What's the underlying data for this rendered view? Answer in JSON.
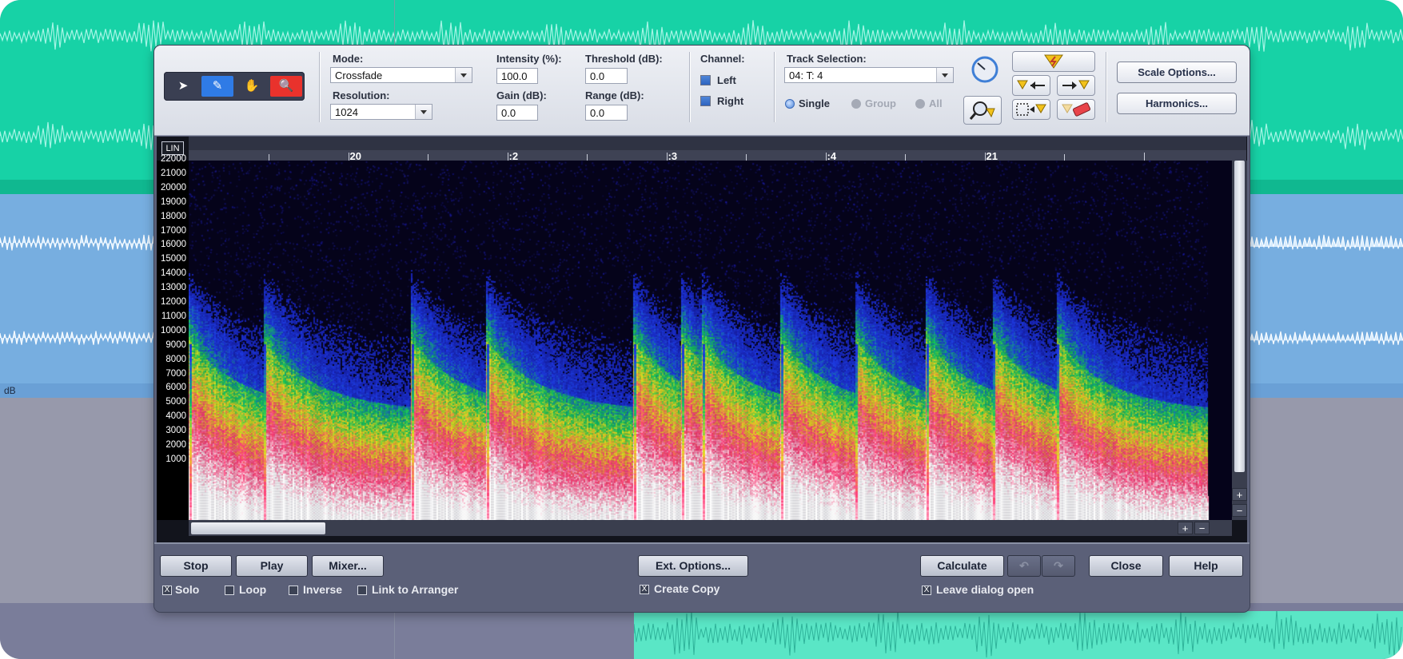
{
  "background": {
    "lane_label": "dB"
  },
  "toolbar": {
    "tools": [
      {
        "name": "pointer",
        "icon": "arrow-pointer-icon",
        "glyph": "➤",
        "color": "#3a3f52"
      },
      {
        "name": "pencil",
        "icon": "pencil-icon",
        "glyph": "✎",
        "color": "#2f7be6"
      },
      {
        "name": "hand",
        "icon": "hand-icon",
        "glyph": "✋",
        "color": "#3a3f52"
      },
      {
        "name": "zoom",
        "icon": "magnifier-icon",
        "glyph": "🔍",
        "color": "#e9322c"
      }
    ],
    "mode_label": "Mode:",
    "mode_value": "Crossfade",
    "resolution_label": "Resolution:",
    "resolution_value": "1024",
    "intensity_label": "Intensity (%):",
    "intensity_value": "100.0",
    "threshold_label": "Threshold (dB):",
    "threshold_value": "0.0",
    "gain_label": "Gain (dB):",
    "gain_value": "0.0",
    "range_label": "Range (dB):",
    "range_value": "0.0",
    "channel_label": "Channel:",
    "left_label": "Left",
    "right_label": "Right",
    "track_selection_label": "Track Selection:",
    "track_value": "04: T:  4",
    "single_label": "Single",
    "group_label": "Group",
    "all_label": "All",
    "scale_options_label": "Scale Options...",
    "harmonics_label": "Harmonics..."
  },
  "spectrogram": {
    "scale_toggle": "LIN",
    "ruler_labels": [
      "20",
      ":2",
      ":3",
      ":4",
      "21"
    ],
    "y_labels": [
      "22000",
      "21000",
      "20000",
      "19000",
      "18000",
      "17000",
      "16000",
      "15000",
      "14000",
      "13000",
      "12000",
      "11000",
      "10000",
      "9000",
      "8000",
      "7000",
      "6000",
      "5000",
      "4000",
      "3000",
      "2000",
      "1000"
    ],
    "colors": {
      "background": "#05031a",
      "low": "#1c1fd0",
      "mid": "#18d43a",
      "high": "#f0e61a",
      "peak": "#ff2d6e",
      "max": "#ffffff"
    }
  },
  "bottom": {
    "stop_label": "Stop",
    "play_label": "Play",
    "mixer_label": "Mixer...",
    "ext_options_label": "Ext. Options...",
    "calculate_label": "Calculate",
    "close_label": "Close",
    "help_label": "Help",
    "solo_label": "Solo",
    "loop_label": "Loop",
    "inverse_label": "Inverse",
    "link_label": "Link to Arranger",
    "create_copy_label": "Create Copy",
    "leave_open_label": "Leave dialog open",
    "check_mark": "X"
  }
}
